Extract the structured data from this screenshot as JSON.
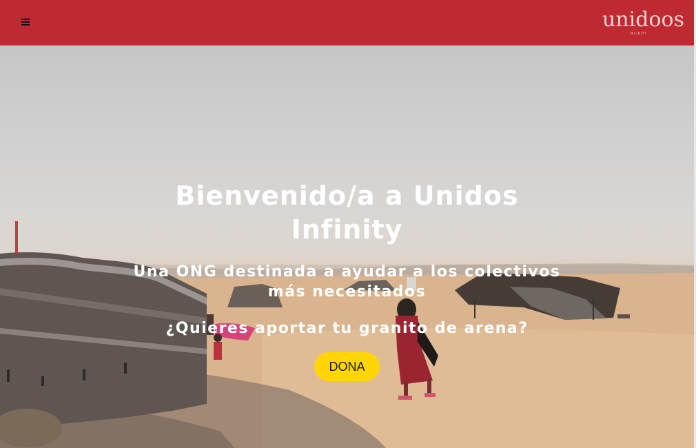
{
  "header": {
    "menu_icon": "hamburger-menu-icon",
    "logo_text": "unidoos",
    "logo_subtext": "INFINITY",
    "background_color": "#bf2a32"
  },
  "hero": {
    "title_line1": "Bienvenido/a a Unidos",
    "title_line2": "Infinity",
    "subtitle_line1": "Una ONG destinada a ayudar a los colectivos",
    "subtitle_line2": "más necesitados",
    "question": "¿Quieres aportar tu granito de arena?",
    "donate_label": "DONA",
    "donate_color": "#ffd600"
  }
}
